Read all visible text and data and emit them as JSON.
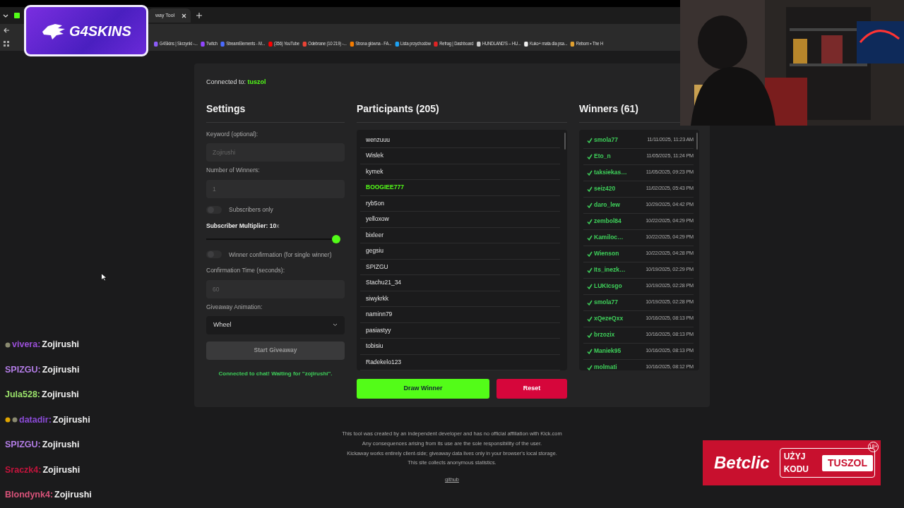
{
  "browser": {
    "tab_title": "way Tool",
    "bookmarks": [
      {
        "label": "G4Skins | Skrzynki -...",
        "color": "#8b5cf6"
      },
      {
        "label": "Twitch",
        "color": "#9146ff"
      },
      {
        "label": "StreamElements - M...",
        "color": "#4b6bff"
      },
      {
        "label": "(356) YouTube",
        "color": "#ff0000"
      },
      {
        "label": "Odebrane (10 219) -...",
        "color": "#ea4335"
      },
      {
        "label": "Strona główna - FA...",
        "color": "#f57c00"
      },
      {
        "label": "Lista przychodów",
        "color": "#1da1f2"
      },
      {
        "label": "Refrag | Dashboard",
        "color": "#e02424"
      },
      {
        "label": "HUNDLAND'S – HU...",
        "color": "#cccccc"
      },
      {
        "label": "Kuko+ mata dla psa...",
        "color": "#eeeeee"
      },
      {
        "label": "Reborn • The H",
        "color": "#e0a030"
      }
    ]
  },
  "logo_overlay": {
    "text": "G4SKINS"
  },
  "connection": {
    "label": "Connected to:",
    "channel": "tuszol"
  },
  "settings": {
    "title": "Settings",
    "items": [
      {
        "kind": "input",
        "label": "Keyword (optional):",
        "placeholder": "Zojirushi"
      },
      {
        "kind": "input",
        "label": "Number of Winners:",
        "placeholder": "1"
      },
      {
        "kind": "toggle",
        "label": "Subscribers only",
        "on": false
      },
      {
        "kind": "slider",
        "label": "**Subscriber Multiplier: 10**x",
        "level": 1
      },
      {
        "kind": "toggle",
        "label": "Winner confirmation (for single winner)",
        "on": false
      },
      {
        "kind": "input",
        "label": "Confirmation Time (seconds):",
        "placeholder": "60"
      },
      {
        "kind": "select",
        "label": "Giveaway Animation:",
        "value": "Wheel"
      }
    ],
    "start_button": {
      "label": "Start Giveaway",
      "disabled": true
    },
    "status": "Connected to chat! Waiting for \"zojirushi\"."
  },
  "participants": {
    "title": "Participants (205)",
    "items": [
      {
        "name": "wenzuuu",
        "highlighted": false
      },
      {
        "name": "Wislek",
        "highlighted": false
      },
      {
        "name": "kymek",
        "highlighted": false
      },
      {
        "name": "BOOGIEE777",
        "highlighted": true
      },
      {
        "name": "ryb5on",
        "highlighted": false
      },
      {
        "name": "yelloxow",
        "highlighted": false
      },
      {
        "name": "bixleer",
        "highlighted": false
      },
      {
        "name": "gegsiu",
        "highlighted": false
      },
      {
        "name": "SPIZGU",
        "highlighted": false
      },
      {
        "name": "Stachu21_34",
        "highlighted": false
      },
      {
        "name": "siwykrkk",
        "highlighted": false
      },
      {
        "name": "naminn79",
        "highlighted": false
      },
      {
        "name": "pasiastyy",
        "highlighted": false
      },
      {
        "name": "tobisiu",
        "highlighted": false
      },
      {
        "name": "Radekelo123",
        "highlighted": false
      }
    ],
    "draw_button": "Draw Winner",
    "reset_button": "Reset"
  },
  "winners": {
    "title": "Winners (61)",
    "items": [
      {
        "name": "smola77",
        "time": "11/11/2025, 11:23 AM"
      },
      {
        "name": "Eto_n",
        "time": "11/05/2025, 11:24 PM"
      },
      {
        "name": "taksiekas…",
        "time": "11/05/2025, 09:23 PM"
      },
      {
        "name": "seiz420",
        "time": "11/02/2025, 05:43 PM"
      },
      {
        "name": "daro_lew",
        "time": "10/29/2025, 04:42 PM"
      },
      {
        "name": "zembol84",
        "time": "10/22/2025, 04:29 PM"
      },
      {
        "name": "Kamiloc…",
        "time": "10/22/2025, 04:29 PM"
      },
      {
        "name": "Wienson",
        "time": "10/22/2025, 04:28 PM"
      },
      {
        "name": "Its_inezk…",
        "time": "10/19/2025, 02:29 PM"
      },
      {
        "name": "LUKIcsgo",
        "time": "10/19/2025, 02:28 PM"
      },
      {
        "name": "smola77",
        "time": "10/19/2025, 02:28 PM"
      },
      {
        "name": "xQezeQxx",
        "time": "10/16/2025, 08:13 PM"
      },
      {
        "name": "brzozix",
        "time": "10/16/2025, 08:13 PM"
      },
      {
        "name": "Maniek95",
        "time": "10/16/2025, 08:13 PM"
      },
      {
        "name": "molmati",
        "time": "10/16/2025, 08:12 PM"
      }
    ]
  },
  "footer": [
    "This tool was created by an independent developer and has no official affiliation with Kick.com",
    "Any consequences arising from its use are the sole responsibility of the user.",
    "Kickaway works entirely client-side; giveaway data lives only in your browser's local storage.",
    "This site collects anonymous statistics."
  ],
  "footer_link": "github",
  "chat": [
    {
      "user": "vivera:",
      "color": "#9b4fd8",
      "message": "Zojirushi",
      "badges": [
        {
          "color": "#8a8a70"
        }
      ]
    },
    {
      "user": "SPIZGU:",
      "color": "#b37de6",
      "message": "Zojirushi"
    },
    {
      "user": "Jula528:",
      "color": "#9be36b",
      "message": "Zojirushi"
    },
    {
      "user": "datadir:",
      "color": "#8a4bd6",
      "message": "Zojirushi",
      "badges": [
        {
          "color": "#e0a500"
        },
        {
          "color": "#8a8a70"
        }
      ]
    },
    {
      "user": "SPIZGU:",
      "color": "#b37de6",
      "message": "Zojirushi"
    },
    {
      "user": "Sraczk4:",
      "color": "#c3143c",
      "message": "Zojirushi"
    },
    {
      "user": "Blondynk4:",
      "color": "#d9537a",
      "message": "Zojirushi"
    }
  ],
  "ad": {
    "brand": "Betclic",
    "cta": "UŻYJ KODU",
    "code": "TUSZOL",
    "age": "18+"
  }
}
